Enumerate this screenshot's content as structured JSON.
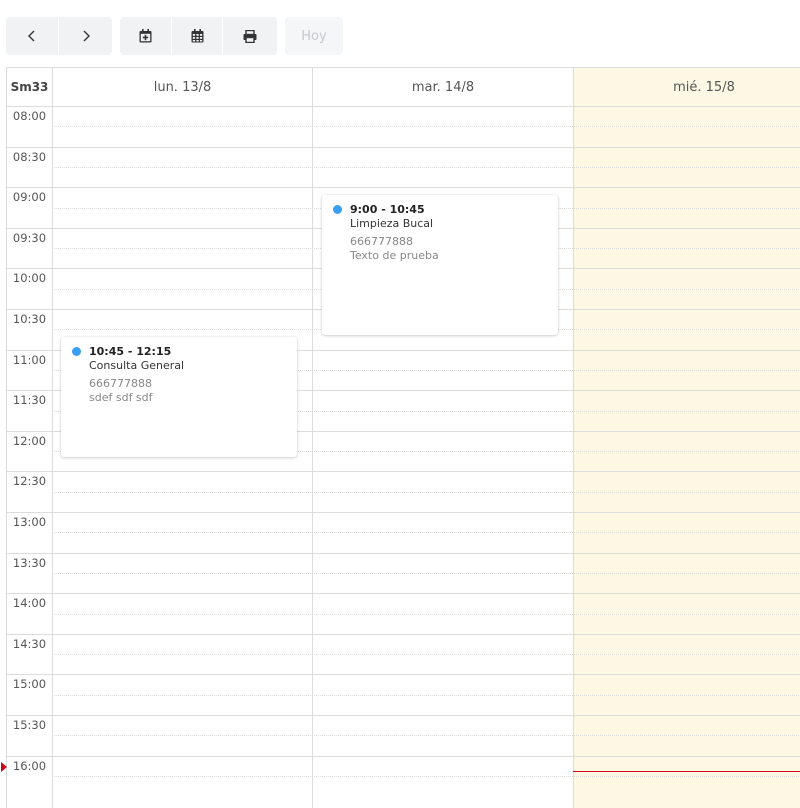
{
  "toolbar": {
    "prev_label": "<",
    "next_label": ">",
    "add_event_icon": "calendar-plus-icon",
    "month_view_icon": "calendar-grid-icon",
    "print_icon": "printer-icon",
    "today_label": "Hoy",
    "button_bg": "#f1f2f4"
  },
  "calendar": {
    "week_label": "Sm33",
    "days": [
      {
        "label": "lun. 13/8",
        "is_today": false
      },
      {
        "label": "mar. 14/8",
        "is_today": false
      },
      {
        "label": "mié. 15/8",
        "is_today": true
      }
    ],
    "time_labels": [
      "08:00",
      "08:30",
      "09:00",
      "09:30",
      "10:00",
      "10:30",
      "11:00",
      "11:30",
      "12:00",
      "12:30",
      "13:00",
      "13:30",
      "14:00",
      "14:30",
      "15:00",
      "15:30",
      "16:00"
    ],
    "today_bg": "#fcf8e3",
    "now_indicator_color": "#d0021b",
    "now_time": "16:00"
  },
  "events": [
    {
      "time": "9:00 - 10:45",
      "title": "Limpieza Bucal",
      "phone": "666777888",
      "note": "Texto de prueba",
      "dot_color": "#3a9ff2"
    },
    {
      "time": "10:45 - 12:15",
      "title": "Consulta General",
      "phone": "666777888",
      "note": "sdef sdf sdf",
      "dot_color": "#3a9ff2"
    }
  ]
}
